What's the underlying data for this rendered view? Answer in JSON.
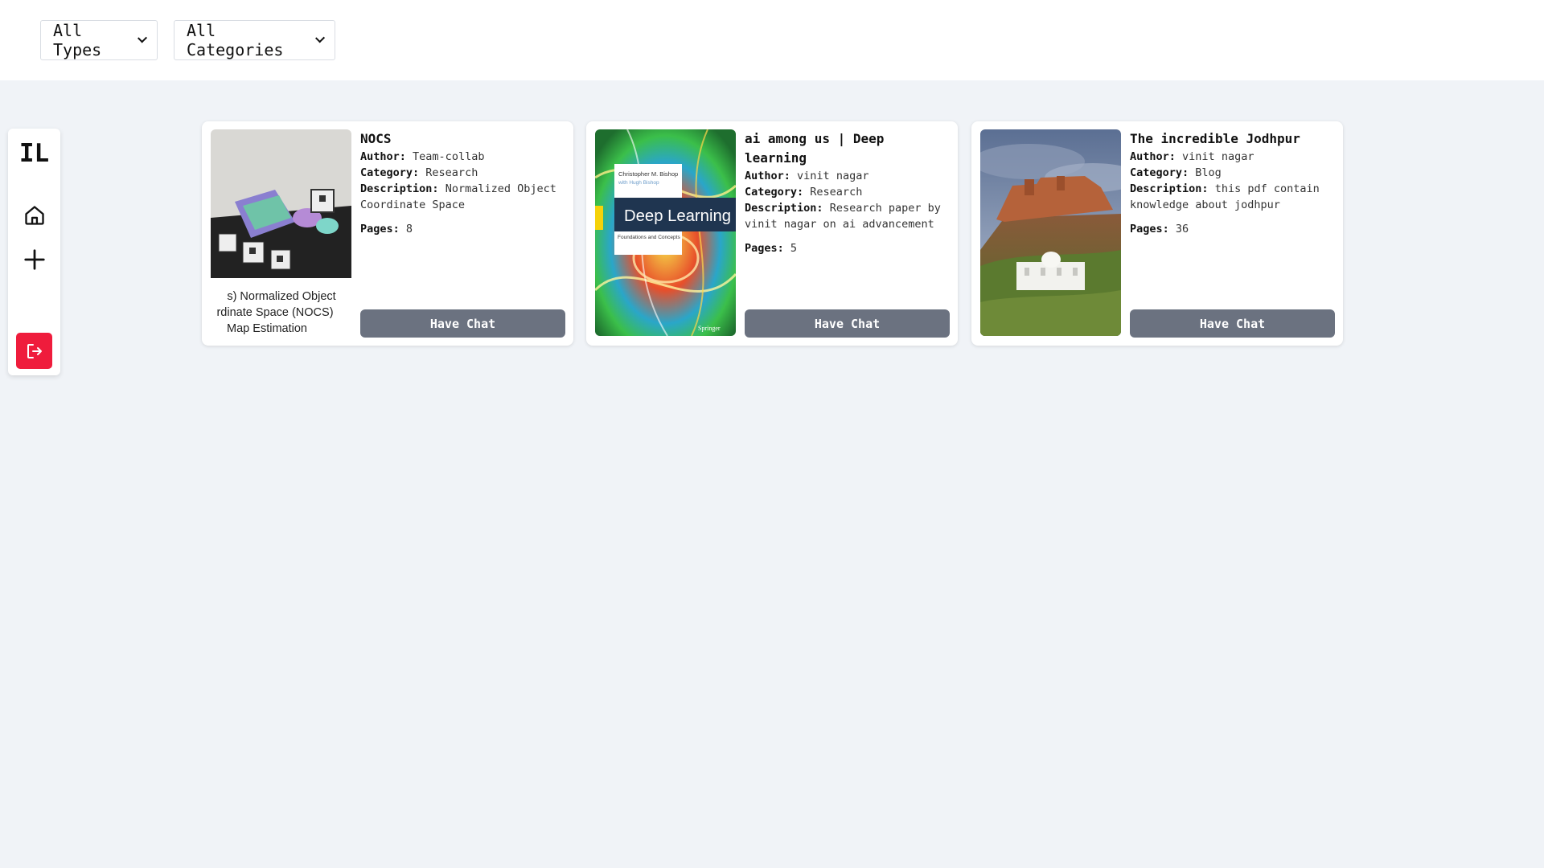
{
  "filters": {
    "type_select": {
      "value": "All Types"
    },
    "category_select": {
      "value": "All Categories"
    }
  },
  "sidebar": {
    "logo": "IL",
    "items": [
      {
        "icon": "home-icon"
      },
      {
        "icon": "plus-icon"
      },
      {
        "icon": "logout-icon"
      }
    ]
  },
  "labels": {
    "author": "Author:",
    "category": "Category:",
    "description": "Description:",
    "pages": "Pages:"
  },
  "cards": [
    {
      "title": "NOCS",
      "author": "Team-collab",
      "category": "Research",
      "description": "Normalized Object Coordinate Space",
      "pages": "8",
      "button": "Have Chat",
      "cover_caption": "s) Normalized Object\nrdinate Space (NOCS)\nMap Estimation"
    },
    {
      "title": "ai among us | Deep learning",
      "author": "vinit nagar",
      "category": "Research",
      "description": "Research paper by vinit nagar on ai advancement",
      "pages": "5",
      "button": "Have Chat",
      "cover_author": "Christopher M. Bishop",
      "cover_coauthor": "with Hugh Bishop",
      "cover_title": "Deep Learning",
      "cover_subtitle": "Foundations and Concepts",
      "cover_publisher": "Springer"
    },
    {
      "title": "The incredible Jodhpur",
      "author": "vinit nagar",
      "category": "Blog",
      "description": "this pdf contain knowledge about jodhpur",
      "pages": "36",
      "button": "Have Chat"
    }
  ],
  "colors": {
    "background": "#f0f3f7",
    "button": "#6b7280",
    "logout": "#ef1c3c"
  }
}
